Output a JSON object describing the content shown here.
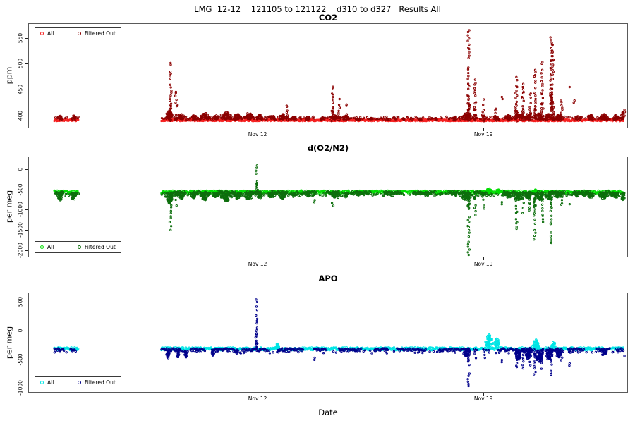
{
  "figure": {
    "background": "#ffffff",
    "frame_color": "#5a5a5a",
    "main_title": "LMG  12-12    121105 to 121122    d310 to d327   Results All"
  },
  "legend": {
    "all_label": "All",
    "filtered_label": "Filtered Out"
  },
  "x_axis": {
    "label": "Date",
    "lim": [
      4.89,
      23.48
    ],
    "ticks": [
      {
        "v": 12,
        "label": "Nov 12"
      },
      {
        "v": 19,
        "label": "Nov 19"
      }
    ]
  },
  "chart_data": [
    {
      "type": "scatter",
      "title": "CO2",
      "ylabel": "ppm",
      "ylim": [
        375,
        578
      ],
      "yticks": [
        400,
        450,
        500,
        550
      ],
      "legend_position": "top-left",
      "series": [
        {
          "name": "All",
          "color": "#f52020"
        },
        {
          "name": "Filtered Out",
          "color": "#8b0000"
        }
      ],
      "baseline": {
        "value": 392,
        "jitter": 1.6,
        "segments": [
          [
            5.68,
            6.42
          ],
          [
            9.0,
            23.32
          ]
        ]
      },
      "filtered_band": {
        "min": 1.5,
        "max": 7,
        "density": 0.6
      },
      "bumps": [
        [
          5.85,
          0.06,
          9
        ],
        [
          6.28,
          0.07,
          10
        ],
        [
          9.25,
          0.1,
          18
        ],
        [
          9.6,
          0.12,
          12
        ],
        [
          10.0,
          0.1,
          10
        ],
        [
          10.35,
          0.12,
          14
        ],
        [
          10.7,
          0.1,
          10
        ],
        [
          11.0,
          0.15,
          16
        ],
        [
          11.35,
          0.12,
          12
        ],
        [
          11.7,
          0.12,
          14
        ],
        [
          12.05,
          0.1,
          10
        ],
        [
          12.4,
          0.12,
          9
        ],
        [
          12.75,
          0.1,
          12
        ],
        [
          13.1,
          0.08,
          8
        ],
        [
          13.55,
          0.08,
          7
        ],
        [
          14.0,
          0.06,
          6
        ],
        [
          14.35,
          0.1,
          10
        ],
        [
          14.7,
          0.08,
          9
        ],
        [
          15.1,
          0.06,
          6
        ],
        [
          15.5,
          0.05,
          5
        ],
        [
          16.0,
          0.05,
          5
        ],
        [
          16.5,
          0.05,
          4
        ],
        [
          17.0,
          0.05,
          4
        ],
        [
          17.5,
          0.05,
          4
        ],
        [
          18.1,
          0.08,
          6
        ],
        [
          18.45,
          0.15,
          14
        ],
        [
          19.4,
          0.08,
          6
        ],
        [
          19.75,
          0.1,
          10
        ],
        [
          20.05,
          0.12,
          14
        ],
        [
          20.35,
          0.1,
          12
        ],
        [
          20.7,
          0.12,
          14
        ],
        [
          21.0,
          0.1,
          12
        ],
        [
          21.3,
          0.1,
          10
        ],
        [
          21.9,
          0.08,
          8
        ],
        [
          22.3,
          0.1,
          10
        ],
        [
          22.7,
          0.12,
          12
        ],
        [
          23.1,
          0.1,
          10
        ],
        [
          23.3,
          0.05,
          16
        ]
      ],
      "spikes": [
        [
          9.28,
          503
        ],
        [
          9.45,
          448
        ],
        [
          12.9,
          421
        ],
        [
          14.3,
          456
        ],
        [
          14.5,
          431
        ],
        [
          14.72,
          424
        ],
        [
          18.52,
          566
        ],
        [
          18.72,
          470
        ],
        [
          18.98,
          432
        ],
        [
          19.35,
          415
        ],
        [
          20.0,
          481
        ],
        [
          20.2,
          463
        ],
        [
          20.42,
          445
        ],
        [
          20.57,
          491
        ],
        [
          20.8,
          506
        ],
        [
          21.08,
          553
        ],
        [
          21.13,
          538
        ],
        [
          21.4,
          431
        ]
      ],
      "dots": [
        [
          21.65,
          456
        ],
        [
          21.8,
          430
        ],
        [
          19.55,
          437
        ],
        [
          23.35,
          412
        ]
      ]
    },
    {
      "type": "scatter",
      "title": "d(O2/N2)",
      "ylabel": "per meg",
      "ylim": [
        -2180,
        310
      ],
      "yticks": [
        0,
        -500,
        -1000,
        -1500,
        -2000
      ],
      "legend_position": "bottom-left",
      "series": [
        {
          "name": "All",
          "color": "#00dd00"
        },
        {
          "name": "Filtered Out",
          "color": "#0c6e0c"
        }
      ],
      "baseline": {
        "value": -550,
        "jitter": 35,
        "segments": [
          [
            5.68,
            6.42
          ],
          [
            9.0,
            23.32
          ]
        ]
      },
      "filtered_band": {
        "min": -100,
        "max": -20,
        "density": 0.55
      },
      "filtered_chunks": [
        [
          5.7,
          5.95
        ],
        [
          9.3,
          9.7
        ],
        [
          10.0,
          10.4
        ],
        [
          10.75,
          11.3
        ],
        [
          11.6,
          12.1
        ],
        [
          12.4,
          12.9
        ],
        [
          13.2,
          13.8
        ],
        [
          14.1,
          14.5
        ],
        [
          14.9,
          15.5
        ],
        [
          15.9,
          16.4
        ],
        [
          16.8,
          17.5
        ],
        [
          17.9,
          18.5
        ],
        [
          18.7,
          19.1
        ],
        [
          19.6,
          20.0
        ],
        [
          20.3,
          20.7
        ],
        [
          21.0,
          21.5
        ],
        [
          21.8,
          22.3
        ],
        [
          22.6,
          23.0
        ]
      ],
      "chunk_offset": -15,
      "bumps": [
        [
          5.85,
          0.06,
          -220
        ],
        [
          6.28,
          0.07,
          -200
        ],
        [
          9.25,
          0.1,
          -280
        ],
        [
          9.6,
          0.12,
          -180
        ],
        [
          10.0,
          0.1,
          -150
        ],
        [
          10.35,
          0.12,
          -200
        ],
        [
          10.7,
          0.1,
          -150
        ],
        [
          11.0,
          0.15,
          -230
        ],
        [
          11.35,
          0.12,
          -170
        ],
        [
          11.7,
          0.12,
          -200
        ],
        [
          12.05,
          0.1,
          -150
        ],
        [
          12.4,
          0.12,
          -140
        ],
        [
          12.75,
          0.1,
          -170
        ],
        [
          13.1,
          0.08,
          -120
        ],
        [
          13.55,
          0.08,
          -110
        ],
        [
          14.35,
          0.1,
          -150
        ],
        [
          14.7,
          0.08,
          -130
        ],
        [
          15.1,
          0.06,
          -90
        ],
        [
          16.0,
          0.05,
          -70
        ],
        [
          17.0,
          0.05,
          -60
        ],
        [
          18.1,
          0.08,
          -90
        ],
        [
          18.45,
          0.15,
          -200
        ],
        [
          19.75,
          0.1,
          -150
        ],
        [
          20.05,
          0.12,
          -200
        ],
        [
          20.35,
          0.1,
          -170
        ],
        [
          20.7,
          0.12,
          -200
        ],
        [
          21.0,
          0.1,
          -180
        ],
        [
          21.3,
          0.1,
          -150
        ],
        [
          21.9,
          0.08,
          -120
        ],
        [
          22.3,
          0.1,
          -140
        ],
        [
          22.7,
          0.12,
          -170
        ],
        [
          23.1,
          0.1,
          -140
        ],
        [
          23.3,
          0.05,
          -200
        ]
      ],
      "spikes": [
        [
          9.28,
          -1480
        ],
        [
          9.45,
          -860
        ],
        [
          11.95,
          130
        ],
        [
          14.3,
          -880
        ],
        [
          14.5,
          -700
        ],
        [
          18.52,
          -2120
        ],
        [
          18.72,
          -1130
        ],
        [
          18.98,
          -940
        ],
        [
          20.0,
          -1480
        ],
        [
          20.2,
          -1060
        ],
        [
          20.42,
          -990
        ],
        [
          20.57,
          -1740
        ],
        [
          20.8,
          -1360
        ],
        [
          21.08,
          -1830
        ],
        [
          21.4,
          -1000
        ]
      ],
      "all_bumps": [
        [
          19.15,
          0.1,
          90
        ],
        [
          19.4,
          0.08,
          70
        ],
        [
          13.3,
          0.06,
          50
        ],
        [
          20.6,
          0.08,
          60
        ]
      ],
      "dots": [
        [
          21.65,
          -850
        ],
        [
          19.55,
          -800
        ],
        [
          13.75,
          -750
        ],
        [
          23.35,
          -700
        ]
      ]
    },
    {
      "type": "scatter",
      "title": "APO",
      "ylabel": "per meg",
      "ylim": [
        -1080,
        660
      ],
      "yticks": [
        500,
        0,
        -500,
        -1000
      ],
      "legend_position": "bottom-left",
      "series": [
        {
          "name": "All",
          "color": "#00e5e5"
        },
        {
          "name": "Filtered Out",
          "color": "#00008b"
        }
      ],
      "baseline": {
        "value": -305,
        "jitter": 25,
        "segments": [
          [
            5.68,
            6.42
          ],
          [
            9.0,
            23.32
          ]
        ]
      },
      "filtered_band": {
        "min": -80,
        "max": -20,
        "density": 0.15
      },
      "filtered_chunks": [
        [
          5.68,
          5.98
        ],
        [
          6.18,
          6.32
        ],
        [
          9.0,
          9.62
        ],
        [
          9.9,
          10.32
        ],
        [
          10.6,
          11.2
        ],
        [
          11.5,
          12.3
        ],
        [
          12.62,
          13.4
        ],
        [
          13.72,
          14.1
        ],
        [
          14.5,
          15.2
        ],
        [
          15.6,
          16.05
        ],
        [
          16.3,
          17.2
        ],
        [
          17.6,
          18.55
        ],
        [
          19.5,
          19.92
        ],
        [
          20.15,
          20.5
        ],
        [
          20.9,
          21.3
        ],
        [
          21.6,
          22.1
        ],
        [
          22.5,
          22.9
        ],
        [
          23.1,
          23.32
        ]
      ],
      "chunk_offset": -15,
      "bumps": [
        [
          9.2,
          0.05,
          -170
        ],
        [
          9.5,
          0.05,
          -150
        ],
        [
          9.75,
          0.05,
          -160
        ],
        [
          10.6,
          0.05,
          -120
        ],
        [
          11.3,
          0.06,
          -100
        ],
        [
          18.45,
          0.1,
          -130
        ],
        [
          20.05,
          0.1,
          -200
        ],
        [
          20.35,
          0.08,
          -180
        ],
        [
          20.7,
          0.1,
          -230
        ],
        [
          21.0,
          0.08,
          -200
        ],
        [
          21.3,
          0.08,
          -160
        ],
        [
          22.7,
          0.08,
          -120
        ]
      ],
      "spikes": [
        [
          11.95,
          560
        ],
        [
          18.52,
          -965
        ],
        [
          18.72,
          -495
        ],
        [
          19.0,
          -450
        ],
        [
          20.0,
          -640
        ],
        [
          20.2,
          -630
        ],
        [
          20.42,
          -600
        ],
        [
          20.57,
          -740
        ],
        [
          20.8,
          -650
        ],
        [
          21.08,
          -770
        ],
        [
          21.4,
          -510
        ]
      ],
      "all_bumps": [
        [
          19.15,
          0.1,
          250
        ],
        [
          19.4,
          0.08,
          180
        ],
        [
          20.6,
          0.1,
          160
        ],
        [
          21.15,
          0.06,
          130
        ],
        [
          12.6,
          0.06,
          90
        ]
      ],
      "dots": [
        [
          21.65,
          -560
        ],
        [
          19.55,
          -500
        ],
        [
          23.35,
          -430
        ],
        [
          13.75,
          -460
        ]
      ]
    }
  ]
}
